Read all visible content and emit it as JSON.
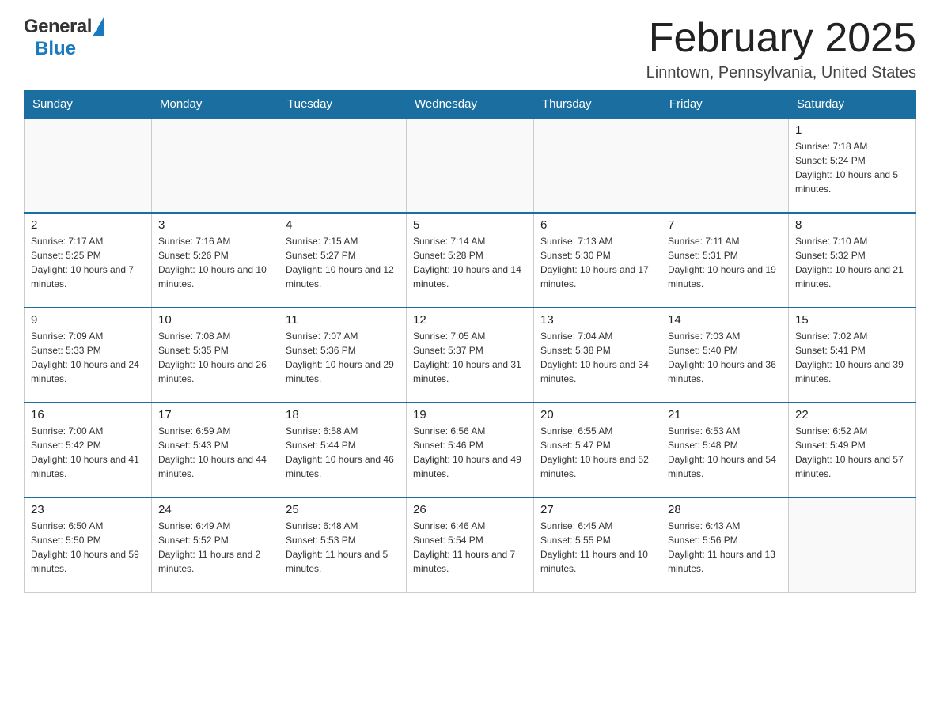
{
  "header": {
    "logo": {
      "general": "General",
      "blue": "Blue"
    },
    "title": "February 2025",
    "location": "Linntown, Pennsylvania, United States"
  },
  "days_of_week": [
    "Sunday",
    "Monday",
    "Tuesday",
    "Wednesday",
    "Thursday",
    "Friday",
    "Saturday"
  ],
  "weeks": [
    [
      {
        "day": "",
        "info": ""
      },
      {
        "day": "",
        "info": ""
      },
      {
        "day": "",
        "info": ""
      },
      {
        "day": "",
        "info": ""
      },
      {
        "day": "",
        "info": ""
      },
      {
        "day": "",
        "info": ""
      },
      {
        "day": "1",
        "info": "Sunrise: 7:18 AM\nSunset: 5:24 PM\nDaylight: 10 hours and 5 minutes."
      }
    ],
    [
      {
        "day": "2",
        "info": "Sunrise: 7:17 AM\nSunset: 5:25 PM\nDaylight: 10 hours and 7 minutes."
      },
      {
        "day": "3",
        "info": "Sunrise: 7:16 AM\nSunset: 5:26 PM\nDaylight: 10 hours and 10 minutes."
      },
      {
        "day": "4",
        "info": "Sunrise: 7:15 AM\nSunset: 5:27 PM\nDaylight: 10 hours and 12 minutes."
      },
      {
        "day": "5",
        "info": "Sunrise: 7:14 AM\nSunset: 5:28 PM\nDaylight: 10 hours and 14 minutes."
      },
      {
        "day": "6",
        "info": "Sunrise: 7:13 AM\nSunset: 5:30 PM\nDaylight: 10 hours and 17 minutes."
      },
      {
        "day": "7",
        "info": "Sunrise: 7:11 AM\nSunset: 5:31 PM\nDaylight: 10 hours and 19 minutes."
      },
      {
        "day": "8",
        "info": "Sunrise: 7:10 AM\nSunset: 5:32 PM\nDaylight: 10 hours and 21 minutes."
      }
    ],
    [
      {
        "day": "9",
        "info": "Sunrise: 7:09 AM\nSunset: 5:33 PM\nDaylight: 10 hours and 24 minutes."
      },
      {
        "day": "10",
        "info": "Sunrise: 7:08 AM\nSunset: 5:35 PM\nDaylight: 10 hours and 26 minutes."
      },
      {
        "day": "11",
        "info": "Sunrise: 7:07 AM\nSunset: 5:36 PM\nDaylight: 10 hours and 29 minutes."
      },
      {
        "day": "12",
        "info": "Sunrise: 7:05 AM\nSunset: 5:37 PM\nDaylight: 10 hours and 31 minutes."
      },
      {
        "day": "13",
        "info": "Sunrise: 7:04 AM\nSunset: 5:38 PM\nDaylight: 10 hours and 34 minutes."
      },
      {
        "day": "14",
        "info": "Sunrise: 7:03 AM\nSunset: 5:40 PM\nDaylight: 10 hours and 36 minutes."
      },
      {
        "day": "15",
        "info": "Sunrise: 7:02 AM\nSunset: 5:41 PM\nDaylight: 10 hours and 39 minutes."
      }
    ],
    [
      {
        "day": "16",
        "info": "Sunrise: 7:00 AM\nSunset: 5:42 PM\nDaylight: 10 hours and 41 minutes."
      },
      {
        "day": "17",
        "info": "Sunrise: 6:59 AM\nSunset: 5:43 PM\nDaylight: 10 hours and 44 minutes."
      },
      {
        "day": "18",
        "info": "Sunrise: 6:58 AM\nSunset: 5:44 PM\nDaylight: 10 hours and 46 minutes."
      },
      {
        "day": "19",
        "info": "Sunrise: 6:56 AM\nSunset: 5:46 PM\nDaylight: 10 hours and 49 minutes."
      },
      {
        "day": "20",
        "info": "Sunrise: 6:55 AM\nSunset: 5:47 PM\nDaylight: 10 hours and 52 minutes."
      },
      {
        "day": "21",
        "info": "Sunrise: 6:53 AM\nSunset: 5:48 PM\nDaylight: 10 hours and 54 minutes."
      },
      {
        "day": "22",
        "info": "Sunrise: 6:52 AM\nSunset: 5:49 PM\nDaylight: 10 hours and 57 minutes."
      }
    ],
    [
      {
        "day": "23",
        "info": "Sunrise: 6:50 AM\nSunset: 5:50 PM\nDaylight: 10 hours and 59 minutes."
      },
      {
        "day": "24",
        "info": "Sunrise: 6:49 AM\nSunset: 5:52 PM\nDaylight: 11 hours and 2 minutes."
      },
      {
        "day": "25",
        "info": "Sunrise: 6:48 AM\nSunset: 5:53 PM\nDaylight: 11 hours and 5 minutes."
      },
      {
        "day": "26",
        "info": "Sunrise: 6:46 AM\nSunset: 5:54 PM\nDaylight: 11 hours and 7 minutes."
      },
      {
        "day": "27",
        "info": "Sunrise: 6:45 AM\nSunset: 5:55 PM\nDaylight: 11 hours and 10 minutes."
      },
      {
        "day": "28",
        "info": "Sunrise: 6:43 AM\nSunset: 5:56 PM\nDaylight: 11 hours and 13 minutes."
      },
      {
        "day": "",
        "info": ""
      }
    ]
  ]
}
